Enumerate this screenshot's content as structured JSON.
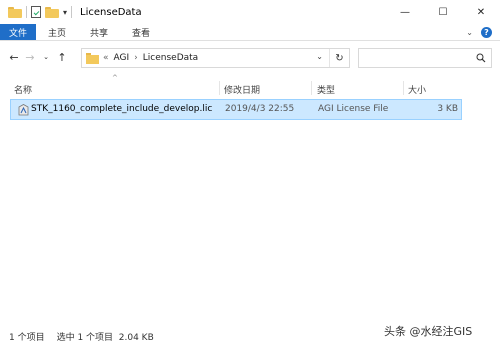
{
  "window": {
    "title": "LicenseData",
    "controls": [
      "—",
      "☐",
      "✕"
    ]
  },
  "ribbon": {
    "tabs": [
      "文件",
      "主页",
      "共享",
      "查看"
    ]
  },
  "address": {
    "overflow": "«",
    "crumbs": [
      "AGI",
      "LicenseData"
    ],
    "separator": "›"
  },
  "columns": {
    "name": "名称",
    "date": "修改日期",
    "type": "类型",
    "size": "大小"
  },
  "files": [
    {
      "name": "STK_1160_complete_include_develop.lic",
      "date": "2019/4/3 22:55",
      "type": "AGI License File",
      "size": "3 KB"
    }
  ],
  "status": {
    "count": "1 个项目",
    "selected": "选中 1 个项目  2.04 KB"
  },
  "watermark": "头条 @水经注GIS"
}
